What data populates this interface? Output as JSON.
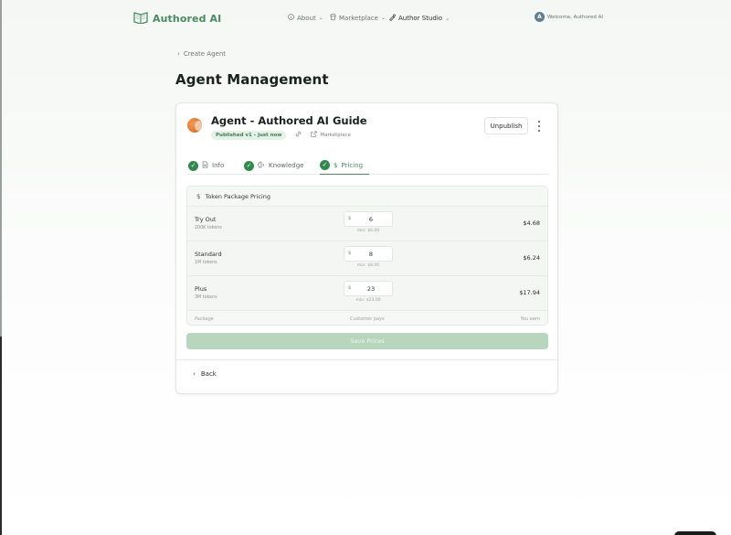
{
  "brand": {
    "name": "Authored AI"
  },
  "nav": {
    "items": [
      {
        "label": "About",
        "icon": "info-icon"
      },
      {
        "label": "Marketplace",
        "icon": "store-icon"
      },
      {
        "label": "Author Studio",
        "icon": "pen-tool-icon"
      }
    ],
    "welcome": "Welcome, Authored AI",
    "avatar_initials": "A"
  },
  "breadcrumb": {
    "back_label": "Create Agent"
  },
  "page": {
    "title": "Agent Management"
  },
  "agent": {
    "title": "Agent - Authored AI Guide",
    "status_badge": "Published v1 - just now",
    "marketplace_link": "Marketplace",
    "unpublish_label": "Unpublish"
  },
  "tabs": [
    {
      "label": "Info",
      "completed": true,
      "active": false
    },
    {
      "label": "Knowledge",
      "completed": true,
      "active": false
    },
    {
      "label": "Pricing",
      "completed": true,
      "active": true
    }
  ],
  "pricing": {
    "title": "Token Package Pricing",
    "currency_symbol": "$",
    "rows": [
      {
        "name": "Try Out",
        "tokens": "200K tokens",
        "price": "6",
        "min": "min: $6.00",
        "earn": "$4.68"
      },
      {
        "name": "Standard",
        "tokens": "1M tokens",
        "price": "8",
        "min": "min: $8.00",
        "earn": "$6.24"
      },
      {
        "name": "Plus",
        "tokens": "3M tokens",
        "price": "23",
        "min": "min: $23.00",
        "earn": "$17.94"
      }
    ],
    "footer": {
      "package": "Package",
      "customer_pays": "Customer pays",
      "you_earn": "You earn"
    },
    "save_label": "Save Prices"
  },
  "back_label": "Back",
  "colors": {
    "accent": "#4c8a63",
    "check": "#2f8a4c",
    "save_disabled": "#b8d6be"
  }
}
